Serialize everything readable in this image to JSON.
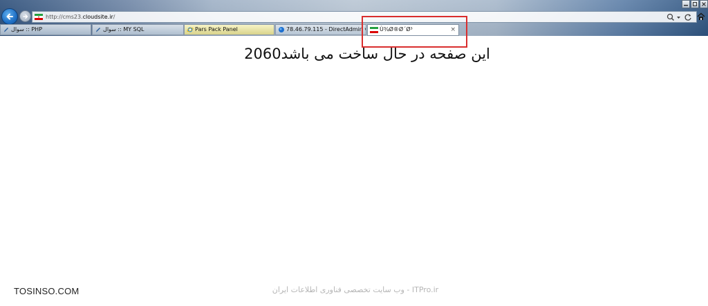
{
  "browser": {
    "url_prefix": "http://cms23.",
    "url_host": "cloudsite.ir",
    "url_suffix": "/",
    "tabs": [
      {
        "label": "سوال :: PHP",
        "icon": "pen-icon"
      },
      {
        "label": "سوال :: MY SQL",
        "icon": "pen-icon"
      },
      {
        "label": "Pars Pack Panel",
        "icon": "ie-icon"
      },
      {
        "label": "78.46.79.115 - DirectAdmin v1....",
        "icon": "globe-icon"
      },
      {
        "label": "Ù¾Ø®Ø´Ø³",
        "icon": "iran-flag-icon",
        "active": true
      }
    ],
    "close_glyph": "×"
  },
  "page": {
    "heading": "این صفحه در حال ساخت می باشد2060"
  },
  "watermark": {
    "left": "TOSINSO.COM",
    "center": "ITPro.ir - وب سایت تخصصی فناوری اطلاعات ایران"
  },
  "colors": {
    "highlight": "#d92d2d",
    "back_button": "#1f6fc4"
  }
}
